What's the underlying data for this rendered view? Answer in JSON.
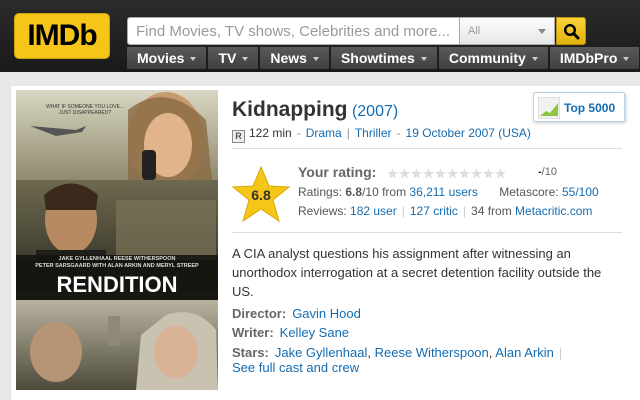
{
  "header": {
    "logo_text": "IMDb",
    "search_placeholder": "Find Movies, TV shows, Celebrities and more...",
    "search_category": "All",
    "nav": [
      {
        "label": "Movies"
      },
      {
        "label": "TV"
      },
      {
        "label": "News"
      },
      {
        "label": "Showtimes"
      },
      {
        "label": "Community"
      },
      {
        "label": "IMDbPro"
      }
    ]
  },
  "poster": {
    "tagline_line1": "WHAT IF SOMEONE YOU LOVE...",
    "tagline_line2": "JUST DISAPPEARED?",
    "cast_line1": "JAKE GYLLENHAAL   REESE WITHERSPOON",
    "cast_line2": "PETER SARSGAARD  WITH ALAN ARKIN  AND MERYL STREEP",
    "title": "RENDITION"
  },
  "movie": {
    "title": "Kidnapping",
    "year": "(2007)",
    "certificate": "R",
    "runtime": "122 min",
    "genres": [
      "Drama",
      "Thriller"
    ],
    "release": "19 October 2007 (USA)",
    "top_badge": "Top 5000",
    "rating_value": "6.8",
    "your_rating_label": "Your rating:",
    "your_rating_value": "-",
    "your_rating_scale": "/10",
    "ratings_label": "Ratings:",
    "ratings_score": "6.8",
    "ratings_scale": "/10 from",
    "ratings_users": "36,211 users",
    "metascore_label": "Metascore:",
    "metascore_value": "55/100",
    "reviews_label": "Reviews:",
    "reviews_user": "182 user",
    "reviews_critic": "127 critic",
    "reviews_meta_count": "34 from",
    "reviews_meta_source": "Metacritic.com",
    "plot": "A CIA analyst questions his assignment after witnessing an unorthodox interrogation at a secret detention facility outside the US.",
    "director_label": "Director:",
    "director": "Gavin Hood",
    "writer_label": "Writer:",
    "writer": "Kelley Sane",
    "stars_label": "Stars:",
    "stars": [
      "Jake Gyllenhaal",
      "Reese Witherspoon",
      "Alan Arkin"
    ],
    "full_cast": "See full cast and crew"
  },
  "colors": {
    "brand_yellow": "#f5c518",
    "link_blue": "#136cb2",
    "header_bg": "#1f1f1f",
    "nav_bg": "#4a4a4a"
  }
}
